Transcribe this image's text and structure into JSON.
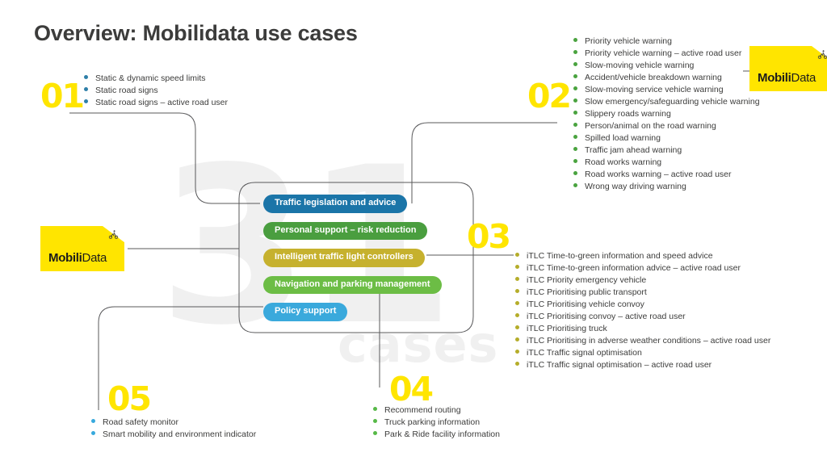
{
  "page_title": "Overview: Mobilidata use cases",
  "watermark": {
    "number": "31",
    "word": "cases"
  },
  "colors": {
    "yellow": "#ffe500",
    "blue_dark": "#1b75a8",
    "green_dark": "#4a9e3f",
    "gold": "#c6b12e",
    "green_light": "#6cbd45",
    "blue_light": "#3aa9dc"
  },
  "logo": {
    "name_bold": "Mobili",
    "name_light": "Data",
    "corner_icon": "cyclist-icon",
    "corner_glyph": "♒"
  },
  "center": {
    "pills": [
      {
        "label": "Traffic legislation and advice",
        "color": "#1b75a8"
      },
      {
        "label": "Personal support – risk reduction",
        "color": "#4a9e3f"
      },
      {
        "label": "Intelligent traffic light controllers",
        "color": "#c6b12e"
      },
      {
        "label": "Navigation and parking management",
        "color": "#6cbd45"
      },
      {
        "label": "Policy support",
        "color": "#3aa9dc"
      }
    ]
  },
  "sections": [
    {
      "number": "01",
      "bullet_color": "#2e7fa8",
      "items": [
        "Static & dynamic speed limits",
        "Static road signs",
        "Static road signs – active road user"
      ]
    },
    {
      "number": "02",
      "bullet_color": "#4aa33f",
      "items": [
        "Priority vehicle warning",
        "Priority vehicle warning – active road user",
        "Slow-moving vehicle warning",
        "Accident/vehicle breakdown warning",
        "Slow-moving service vehicle warning",
        "Slow emergency/safeguarding vehicle warning",
        "Slippery roads warning",
        "Person/animal on the road warning",
        "Spilled load warning",
        "Traffic jam ahead warning",
        "Road works warning",
        "Road works warning – active road user",
        "Wrong way driving warning"
      ]
    },
    {
      "number": "03",
      "bullet_color": "#b5ad2a",
      "items": [
        "iTLC Time-to-green information and speed advice",
        "iTLC Time-to-green information advice – active road user",
        "iTLC Priority emergency vehicle",
        "iTLC Prioritising public transport",
        "iTLC Prioritising vehicle convoy",
        "iTLC Prioritising convoy – active road user",
        "iTLC Prioritising truck",
        "iTLC Prioritising in adverse weather conditions – active road user",
        "iTLC Traffic signal optimisation",
        "iTLC Traffic signal optimisation – active road user"
      ]
    },
    {
      "number": "04",
      "bullet_color": "#57b947",
      "items": [
        "Recommend routing",
        "Truck parking information",
        "Park & Ride facility information"
      ]
    },
    {
      "number": "05",
      "bullet_color": "#37a9dd",
      "items": [
        "Road safety monitor",
        "Smart mobility and environment indicator"
      ]
    }
  ]
}
